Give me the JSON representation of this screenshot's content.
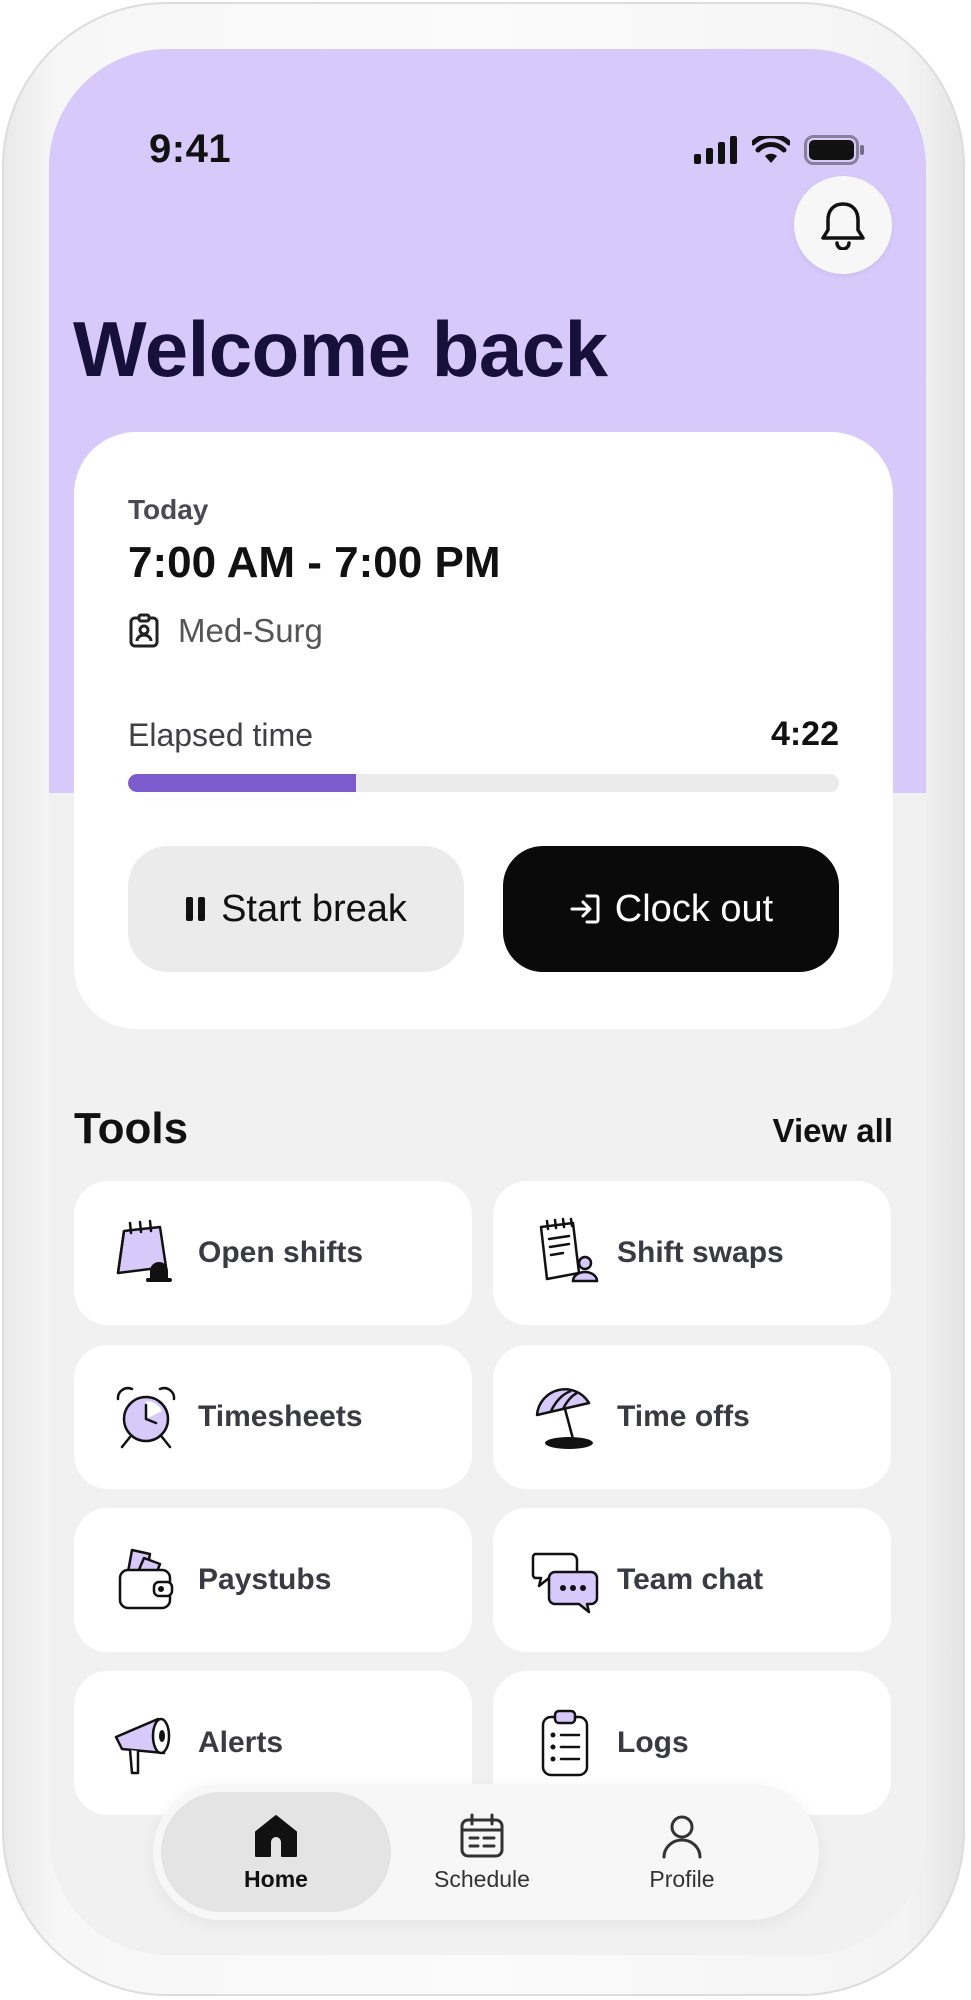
{
  "status_bar": {
    "time": "9:41"
  },
  "header": {
    "title": "Welcome back"
  },
  "shift": {
    "day_label": "Today",
    "time_range": "7:00 AM - 7:00 PM",
    "unit": "Med-Surg",
    "elapsed_label": "Elapsed time",
    "elapsed_value": "4:22",
    "progress_fraction": 0.32
  },
  "actions": {
    "start_break_label": "Start break",
    "clock_out_label": "Clock out"
  },
  "tools": {
    "title": "Tools",
    "view_all_label": "View all",
    "items": [
      {
        "label": "Open shifts",
        "icon": "calendar-bell-icon"
      },
      {
        "label": "Shift swaps",
        "icon": "notepad-person-icon"
      },
      {
        "label": "Timesheets",
        "icon": "alarm-clock-icon"
      },
      {
        "label": "Time offs",
        "icon": "beach-umbrella-icon"
      },
      {
        "label": "Paystubs",
        "icon": "wallet-icon"
      },
      {
        "label": "Team chat",
        "icon": "chat-bubbles-icon"
      },
      {
        "label": "Alerts",
        "icon": "megaphone-icon"
      },
      {
        "label": "Logs",
        "icon": "clipboard-list-icon"
      }
    ]
  },
  "nav": {
    "items": [
      {
        "label": "Home",
        "icon": "home-icon",
        "active": true
      },
      {
        "label": "Schedule",
        "icon": "calendar-icon",
        "active": false
      },
      {
        "label": "Profile",
        "icon": "person-icon",
        "active": false
      }
    ]
  },
  "colors": {
    "hero_background": "#d8c9fb",
    "accent": "#7c5ccd",
    "screen_background": "#f1f1f1",
    "title_text": "#17103a",
    "primary_button": "#0a0a0b"
  }
}
